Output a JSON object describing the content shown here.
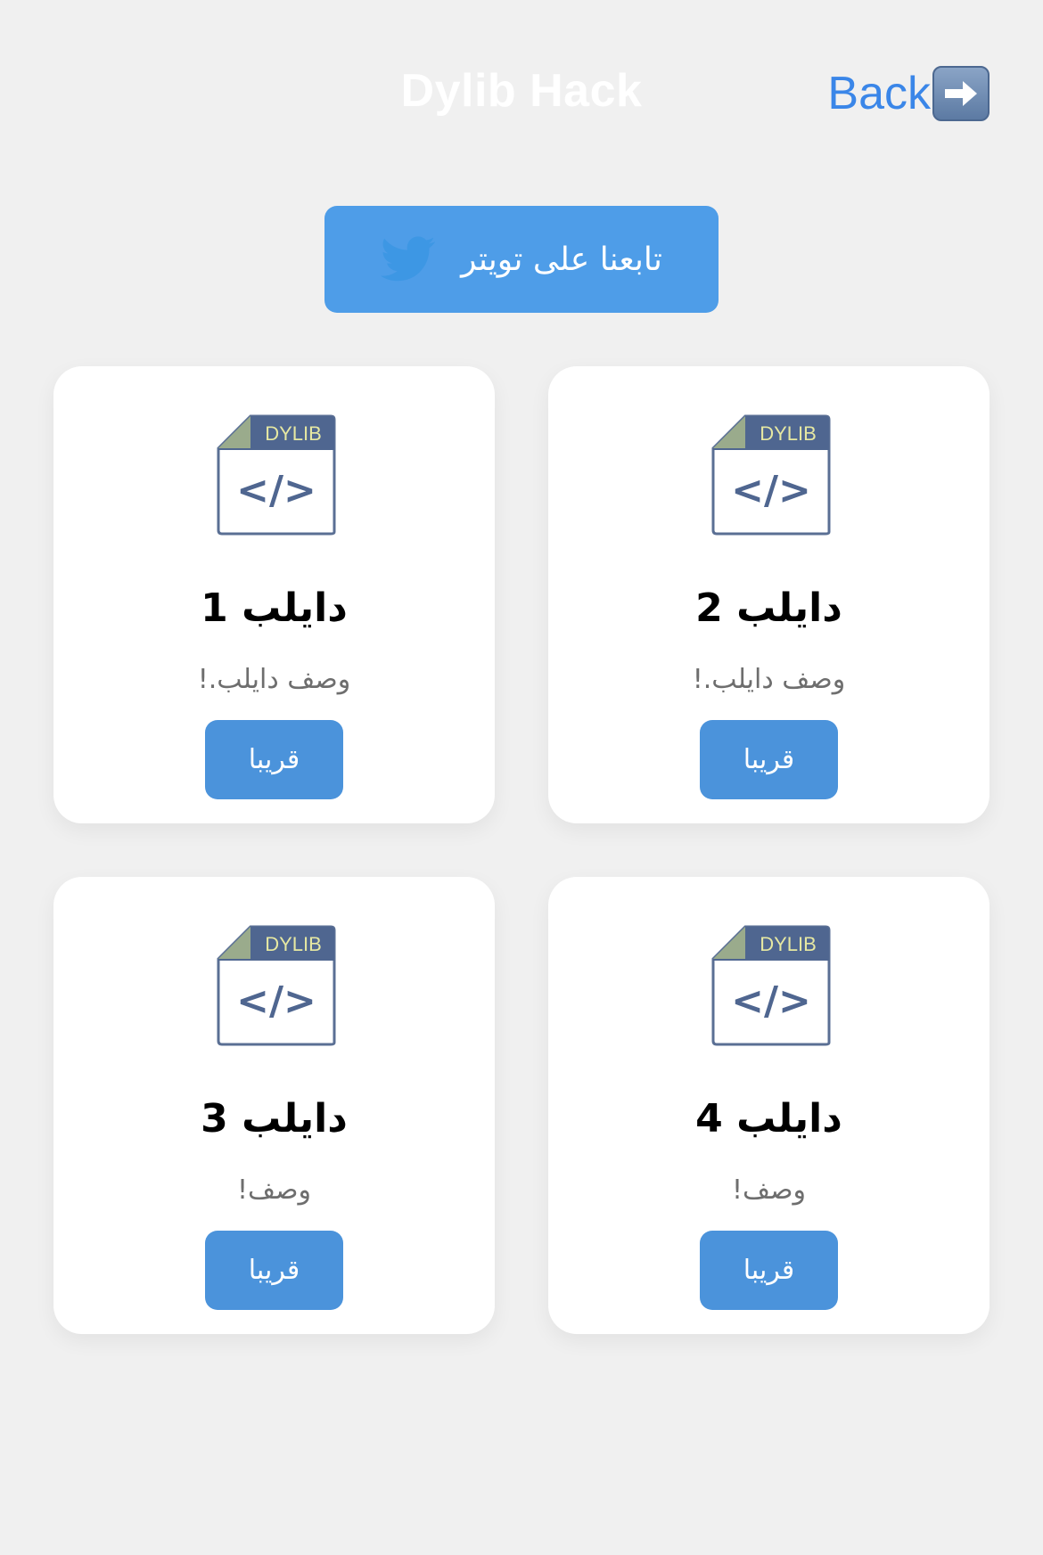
{
  "header": {
    "title": "Dylib Hack",
    "back_label": "Back",
    "back_icon": "right-arrow-icon"
  },
  "twitter_button": {
    "label": "تابعنا على تويتر",
    "icon": "twitter-bird-icon"
  },
  "cards": [
    {
      "title": "دايلب 1",
      "description": "وصف دايلب.!",
      "button_label": "قريبا",
      "icon_label": "DYLIB"
    },
    {
      "title": "دايلب 2",
      "description": "وصف دايلب.!",
      "button_label": "قريبا",
      "icon_label": "DYLIB"
    },
    {
      "title": "دايلب 3",
      "description": "وصف!",
      "button_label": "قريبا",
      "icon_label": "DYLIB"
    },
    {
      "title": "دايلب 4",
      "description": "وصف!",
      "button_label": "قريبا",
      "icon_label": "DYLIB"
    }
  ],
  "colors": {
    "background": "#f0f0f0",
    "accent_blue": "#4b93db",
    "twitter_blue": "#4e9de8",
    "link_blue": "#3a86e8",
    "card": "#ffffff"
  }
}
